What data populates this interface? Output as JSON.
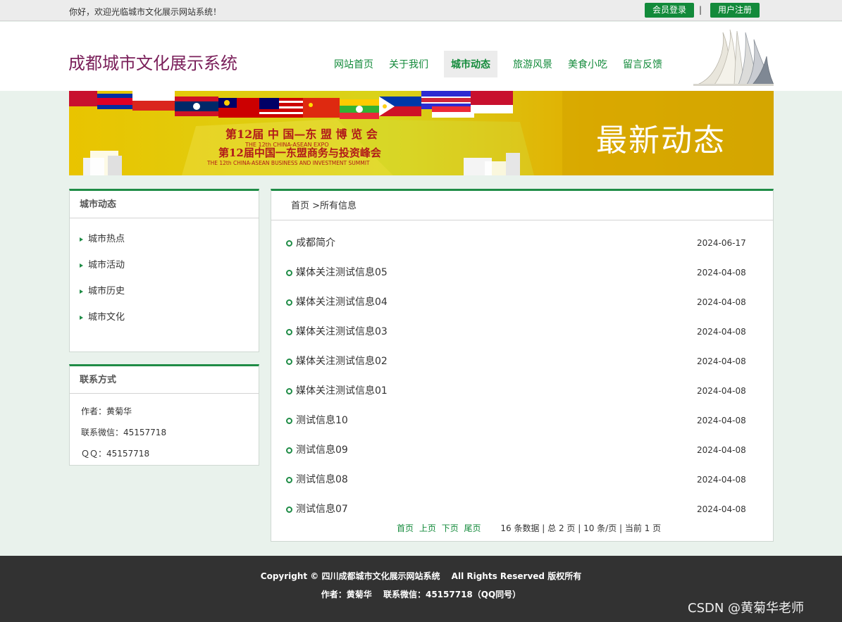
{
  "topbar": {
    "welcome": "你好，欢迎光临城市文化展示网站系统！",
    "login_label": "会员登录",
    "separator": "|",
    "register_label": "用户注册"
  },
  "header": {
    "site_title": "成都城市文化展示系统",
    "nav": [
      {
        "label": "网站首页",
        "active": false
      },
      {
        "label": "关于我们",
        "active": false
      },
      {
        "label": "城市动态",
        "active": true
      },
      {
        "label": "旅游风景",
        "active": false
      },
      {
        "label": "美食小吃",
        "active": false
      },
      {
        "label": "留言反馈",
        "active": false
      }
    ]
  },
  "banner": {
    "title": "最新动态",
    "expo_line1": "第12届 中 国—东 盟 博 览 会",
    "expo_line1_en": "THE 12th CHINA-ASEAN EXPO",
    "expo_line2": "第12届中国一东盟商务与投资峰会",
    "expo_line2_en": "THE 12th CHINA-ASEAN BUSINESS AND INVESTMENT SUMMIT"
  },
  "sidebar": {
    "category_title": "城市动态",
    "categories": [
      "城市热点",
      "城市活动",
      "城市历史",
      "城市文化"
    ],
    "contact_title": "联系方式",
    "contact": [
      "作者：黄菊华",
      "联系微信：45157718",
      "ＱＱ：45157718"
    ]
  },
  "main": {
    "breadcrumb": "首页 >所有信息",
    "news": [
      {
        "title": "成都简介",
        "date": "2024-06-17"
      },
      {
        "title": "媒体关注测试信息05",
        "date": "2024-04-08"
      },
      {
        "title": "媒体关注测试信息04",
        "date": "2024-04-08"
      },
      {
        "title": "媒体关注测试信息03",
        "date": "2024-04-08"
      },
      {
        "title": "媒体关注测试信息02",
        "date": "2024-04-08"
      },
      {
        "title": "媒体关注测试信息01",
        "date": "2024-04-08"
      },
      {
        "title": "测试信息10",
        "date": "2024-04-08"
      },
      {
        "title": "测试信息09",
        "date": "2024-04-08"
      },
      {
        "title": "测试信息08",
        "date": "2024-04-08"
      },
      {
        "title": "测试信息07",
        "date": "2024-04-08"
      }
    ],
    "pager": {
      "first": "首页",
      "prev": "上页",
      "next": "下页",
      "last": "尾页",
      "info": "16 条数据 | 总 2 页 | 10 条/页 | 当前 1 页"
    }
  },
  "footer": {
    "copyright": "Copyright © 四川成都城市文化展示网站系统　 All Rights Reserved 版权所有",
    "author_line": "作者：黄菊华　 联系微信：45157718（QQ同号）",
    "watermark": "CSDN @黄菊华老师"
  },
  "colors": {
    "brand_green": "#128a3a",
    "title_purple": "#7a1f5a",
    "page_bg": "#e9f2ec",
    "footer_bg": "#323232"
  }
}
